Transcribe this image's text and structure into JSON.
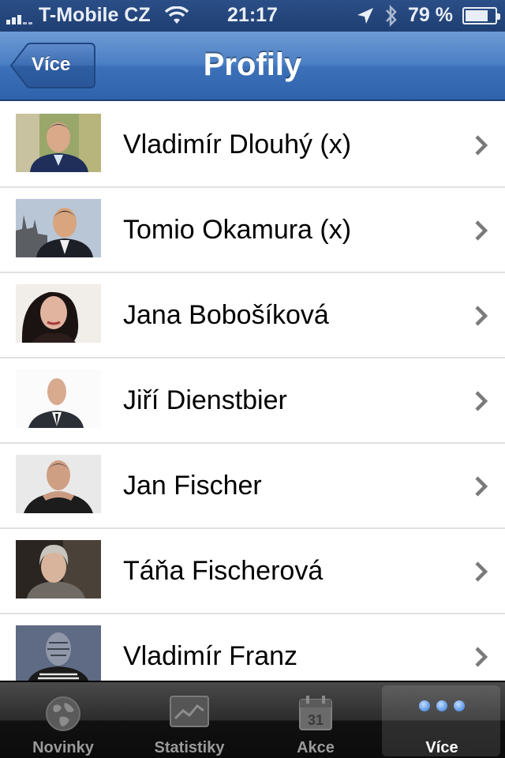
{
  "status_bar": {
    "carrier": "T-Mobile CZ",
    "time": "21:17",
    "battery_percent": "79 %",
    "battery_level": 0.79
  },
  "nav": {
    "back_label": "Více",
    "title": "Profily"
  },
  "profiles": [
    {
      "name": "Vladimír Dlouhý (x)",
      "photo": "person-photo"
    },
    {
      "name": "Tomio Okamura (x)",
      "photo": "person-photo"
    },
    {
      "name": "Jana Bobošíková",
      "photo": "person-photo"
    },
    {
      "name": "Jiří Dienstbier",
      "photo": "person-photo"
    },
    {
      "name": "Jan Fischer",
      "photo": "person-photo"
    },
    {
      "name": "Táňa Fischerová",
      "photo": "person-photo"
    },
    {
      "name": "Vladimír Franz",
      "photo": "person-photo"
    }
  ],
  "tabs": [
    {
      "label": "Novinky",
      "icon": "globe-icon",
      "active": false
    },
    {
      "label": "Statistiky",
      "icon": "chart-icon",
      "active": false
    },
    {
      "label": "Akce",
      "icon": "calendar-icon",
      "active": false,
      "icon_text": "31"
    },
    {
      "label": "Více",
      "icon": "more-icon",
      "active": true
    }
  ],
  "colors": {
    "nav_blue": "#3c71b9",
    "status_bar": "#2a4e86",
    "chevron": "#7a7a7a",
    "separator": "#e0e0e0"
  }
}
